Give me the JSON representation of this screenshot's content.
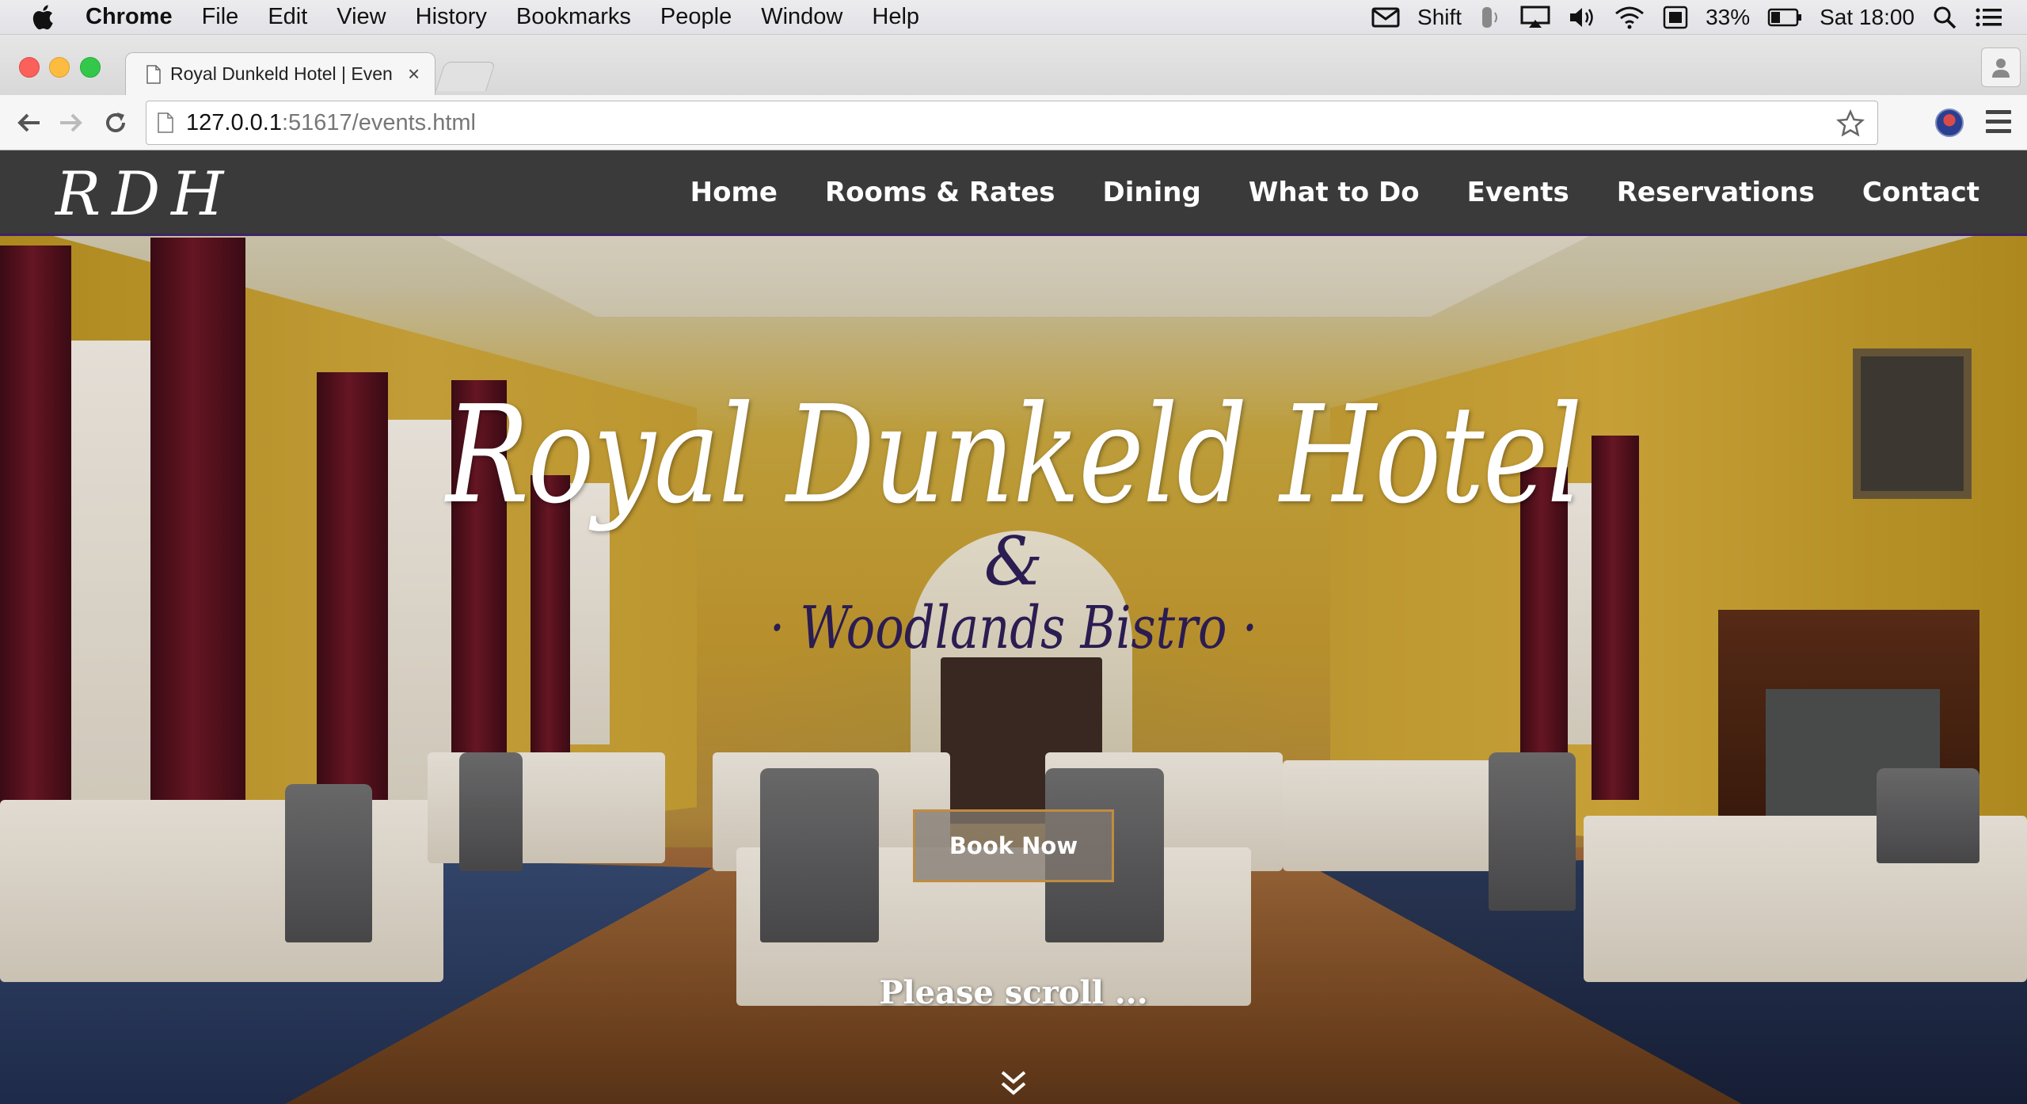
{
  "menubar": {
    "app_name": "Chrome",
    "items": [
      "File",
      "Edit",
      "View",
      "History",
      "Bookmarks",
      "People",
      "Window",
      "Help"
    ],
    "status": {
      "keyboard": "Shift",
      "battery": "33%",
      "clock": "Sat 18:00"
    }
  },
  "browser": {
    "tab_title": "Royal Dunkeld Hotel | Even",
    "tab_close": "×",
    "url_host": "127.0.0.1",
    "url_rest": ":51617/events.html"
  },
  "site": {
    "logo": "RDH",
    "nav": [
      "Home",
      "Rooms & Rates",
      "Dining",
      "What to Do",
      "Events",
      "Reservations",
      "Contact"
    ],
    "hero": {
      "title": "Royal Dunkeld Hotel",
      "ampersand": "&",
      "subtitle": "· Woodlands Bistro ·",
      "cta": "Book Now",
      "scroll_hint": "Please scroll ..."
    }
  },
  "colors": {
    "header_bg": "#3a3a3a",
    "accent_purple": "#2b1c52",
    "button_border": "#c08c42"
  }
}
